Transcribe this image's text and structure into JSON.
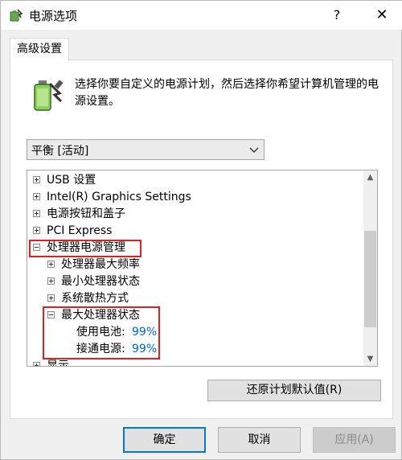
{
  "window": {
    "title": "电源选项",
    "help_label": "?",
    "close_label": "✕"
  },
  "tab": {
    "label": "高级设置"
  },
  "intro": {
    "text": "选择你要自定义的电源计划，然后选择你希望计算机管理的电源设置。"
  },
  "plan_select": {
    "value": "平衡 [活动]"
  },
  "tree": {
    "items": [
      {
        "label": "USB 设置"
      },
      {
        "label": "Intel(R) Graphics Settings"
      },
      {
        "label": "电源按钮和盖子"
      },
      {
        "label": "PCI Express"
      },
      {
        "label": "处理器电源管理"
      },
      {
        "label": "处理器最大频率"
      },
      {
        "label": "最小处理器状态"
      },
      {
        "label": "系统散热方式"
      },
      {
        "label": "最大处理器状态"
      },
      {
        "label": "使用电池:",
        "value": "99%"
      },
      {
        "label": "接通电源:",
        "value": "99%"
      },
      {
        "label": "显示"
      }
    ]
  },
  "restore_button": {
    "label": "还原计划默认值(R)"
  },
  "buttons": {
    "ok": "确定",
    "cancel": "取消",
    "apply": "应用(A)"
  },
  "colors": {
    "highlight": "#e02020",
    "value_text": "#0066cc",
    "accent": "#0078d7"
  }
}
